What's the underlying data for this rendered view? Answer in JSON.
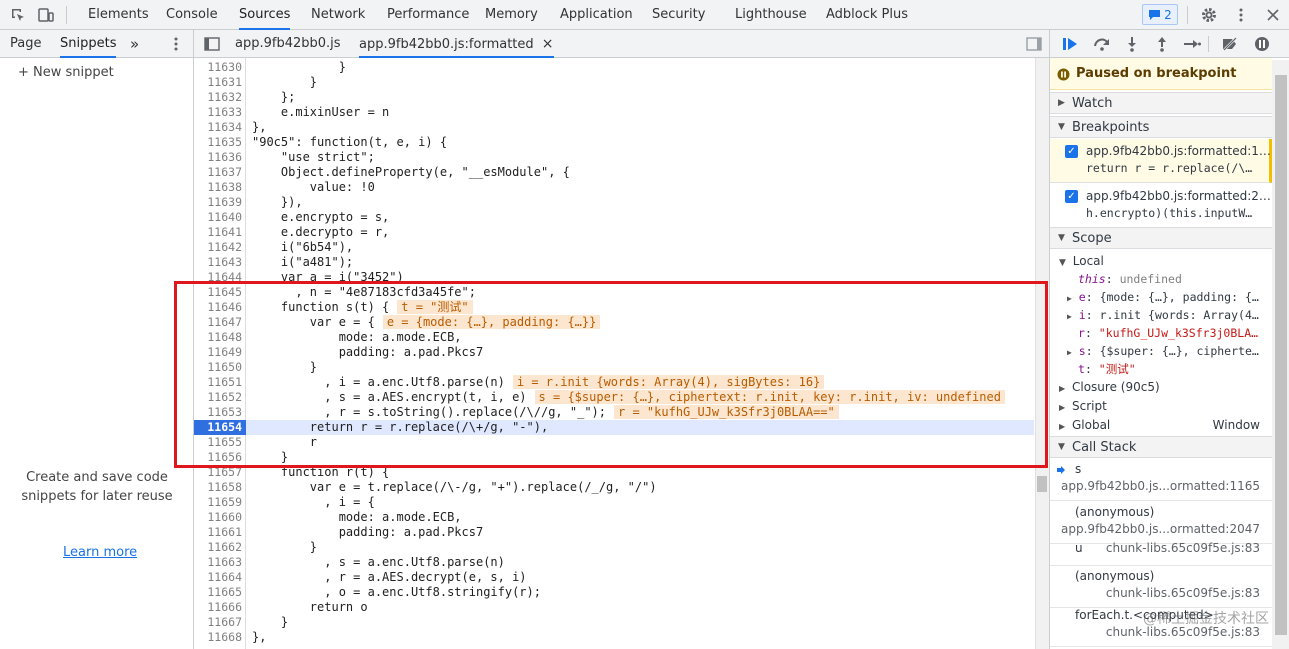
{
  "topbar": {
    "tabs": [
      "Elements",
      "Console",
      "Sources",
      "Network",
      "Performance",
      "Memory",
      "Application",
      "Security",
      "Lighthouse",
      "Adblock Plus"
    ],
    "active_tab": "Sources",
    "issues_count": "2"
  },
  "navigator": {
    "tabs": [
      "Page",
      "Snippets"
    ],
    "active_tab": "Snippets",
    "more": "»",
    "new_snippet": "+ New snippet",
    "hint": "Create and save code snippets for later reuse",
    "learn_more": "Learn more"
  },
  "editor": {
    "tabs": [
      {
        "label": "app.9fb42bb0.js"
      },
      {
        "label": "app.9fb42bb0.js:formatted",
        "close": "×"
      }
    ],
    "lines": [
      {
        "n": "11630",
        "code": "            }"
      },
      {
        "n": "11631",
        "code": "        }"
      },
      {
        "n": "11632",
        "code": "    };"
      },
      {
        "n": "11633",
        "code": "    e.mixinUser = n"
      },
      {
        "n": "11634",
        "code": "},"
      },
      {
        "n": "11635",
        "code": "\"90c5\": function(t, e, i) {"
      },
      {
        "n": "11636",
        "code": "    \"use strict\";"
      },
      {
        "n": "11637",
        "code": "    Object.defineProperty(e, \"__esModule\", {"
      },
      {
        "n": "11638",
        "code": "        value: !0"
      },
      {
        "n": "11639",
        "code": "    }),"
      },
      {
        "n": "11640",
        "code": "    e.encrypto = s,"
      },
      {
        "n": "11641",
        "code": "    e.decrypto = r,"
      },
      {
        "n": "11642",
        "code": "    i(\"6b54\"),"
      },
      {
        "n": "11643",
        "code": "    i(\"a481\");"
      },
      {
        "n": "11644",
        "code": "    var a = i(\"3452\")"
      },
      {
        "n": "11645",
        "code": "      , n = \"4e87183cfd3a45fe\";"
      },
      {
        "n": "11646",
        "code": "    function s(t) {",
        "inline": "t = \"测试\""
      },
      {
        "n": "11647",
        "code": "        var e = {",
        "inline": "e = {mode: {…}, padding: {…}}"
      },
      {
        "n": "11648",
        "code": "            mode: a.mode.ECB,"
      },
      {
        "n": "11649",
        "code": "            padding: a.pad.Pkcs7"
      },
      {
        "n": "11650",
        "code": "        }"
      },
      {
        "n": "11651",
        "code": "          , i = a.enc.Utf8.parse(n)",
        "inline": "i = r.init {words: Array(4), sigBytes: 16}"
      },
      {
        "n": "11652",
        "code": "          , s = a.AES.encrypt(t, i, e)",
        "inline": "s = {$super: {…}, ciphertext: r.init, key: r.init, iv: undefined"
      },
      {
        "n": "11653",
        "code": "          , r = s.toString().replace(/\\//g, \"_\");",
        "inline": "r = \"kufhG_UJw_k3Sfr3j0BLAA==\""
      },
      {
        "n": "11654",
        "code": "        return r = r.replace(/\\+/g, \"-\"),",
        "paused": true
      },
      {
        "n": "11655",
        "code": "        r"
      },
      {
        "n": "11656",
        "code": "    }"
      },
      {
        "n": "11657",
        "code": "    function r(t) {"
      },
      {
        "n": "11658",
        "code": "        var e = t.replace(/\\-/g, \"+\").replace(/_/g, \"/\")"
      },
      {
        "n": "11659",
        "code": "          , i = {"
      },
      {
        "n": "11660",
        "code": "            mode: a.mode.ECB,"
      },
      {
        "n": "11661",
        "code": "            padding: a.pad.Pkcs7"
      },
      {
        "n": "11662",
        "code": "        }"
      },
      {
        "n": "11663",
        "code": "          , s = a.enc.Utf8.parse(n)"
      },
      {
        "n": "11664",
        "code": "          , r = a.AES.decrypt(e, s, i)"
      },
      {
        "n": "11665",
        "code": "          , o = a.enc.Utf8.stringify(r);"
      },
      {
        "n": "11666",
        "code": "        return o"
      },
      {
        "n": "11667",
        "code": "    }"
      },
      {
        "n": "11668",
        "code": "},"
      }
    ]
  },
  "debugger": {
    "paused": "Paused on breakpoint",
    "watch": "Watch",
    "breakpoints_title": "Breakpoints",
    "breakpoints": [
      {
        "file": "app.9fb42bb0.js:formatted:1…",
        "code": "return r = r.replace(/\\…"
      },
      {
        "file": "app.9fb42bb0.js:formatted:2…",
        "code": "h.encrypto)(this.inputW…"
      }
    ],
    "scope_title": "Scope",
    "local_title": "Local",
    "scope_vars": [
      {
        "key": "this",
        "sep": ": ",
        "val": "undefined"
      },
      {
        "key": "e",
        "sep": ": ",
        "val": "{mode: {…}, padding: {…"
      },
      {
        "key": "i",
        "sep": ": ",
        "val": "r.init {words: Array(4…"
      },
      {
        "key": "r",
        "sep": ": ",
        "val": "\"kufhG_UJw_k3Sfr3j0BLA…"
      },
      {
        "key": "s",
        "sep": ": ",
        "val": "{$super: {…}, cipherte…"
      },
      {
        "key": "t",
        "sep": ": ",
        "val": "\"测试\""
      }
    ],
    "closure": "Closure (90c5)",
    "script": "Script",
    "global": "Global",
    "global_val": "Window",
    "callstack_title": "Call Stack",
    "frames": [
      {
        "name": "s",
        "loc": "app.9fb42bb0.js...ormatted:1165"
      },
      {
        "name": "(anonymous)",
        "loc": "app.9fb42bb0.js...ormatted:2047"
      },
      {
        "name": "u",
        "loc": "chunk-libs.65c09f5e.js:83"
      },
      {
        "name": "(anonymous)",
        "loc": "chunk-libs.65c09f5e.js:83"
      },
      {
        "name": "forEach.t.<computed>",
        "loc": "chunk-libs.65c09f5e.js:83"
      }
    ]
  },
  "watermark": "@稀土掘金技术社区"
}
